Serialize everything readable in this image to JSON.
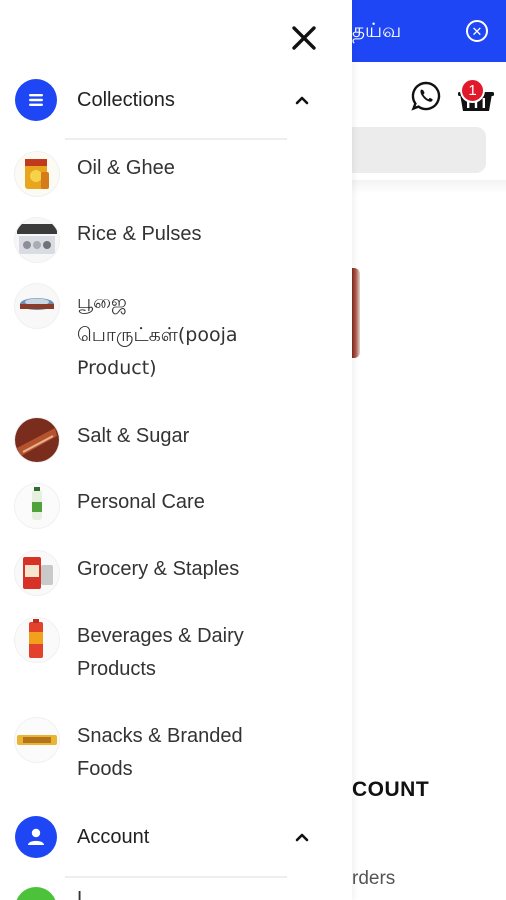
{
  "background": {
    "banner_text": "தய்வ",
    "banner_close_icon": "close-circle-icon",
    "cart_count": "1",
    "account_heading": "COUNT",
    "orders_link": "rders"
  },
  "drawer": {
    "close_icon": "close-icon",
    "collections": {
      "label": "Collections",
      "icon": "menu-lines-icon",
      "expanded": true
    },
    "categories": [
      {
        "label": "Oil & Ghee",
        "icon": "oil-ghee-thumbnail"
      },
      {
        "label": "Rice & Pulses",
        "icon": "rice-pulses-thumbnail"
      },
      {
        "label": "பூஜை பொருட்கள்(pooja Product)",
        "icon": "pooja-product-thumbnail"
      },
      {
        "label": "Salt & Sugar",
        "icon": "salt-sugar-thumbnail"
      },
      {
        "label": "Personal Care",
        "icon": "personal-care-thumbnail"
      },
      {
        "label": "Grocery & Staples",
        "icon": "grocery-staples-thumbnail"
      },
      {
        "label": "Beverages & Dairy Products",
        "icon": "beverages-dairy-thumbnail"
      },
      {
        "label": "Snacks & Branded Foods",
        "icon": "snacks-branded-thumbnail"
      }
    ],
    "account": {
      "label": "Account",
      "icon": "user-icon",
      "expanded": true
    },
    "next_item_partial": "L"
  },
  "colors": {
    "accent_blue": "#1e46f5",
    "badge_red": "#e0192b",
    "green": "#4cc13a"
  }
}
